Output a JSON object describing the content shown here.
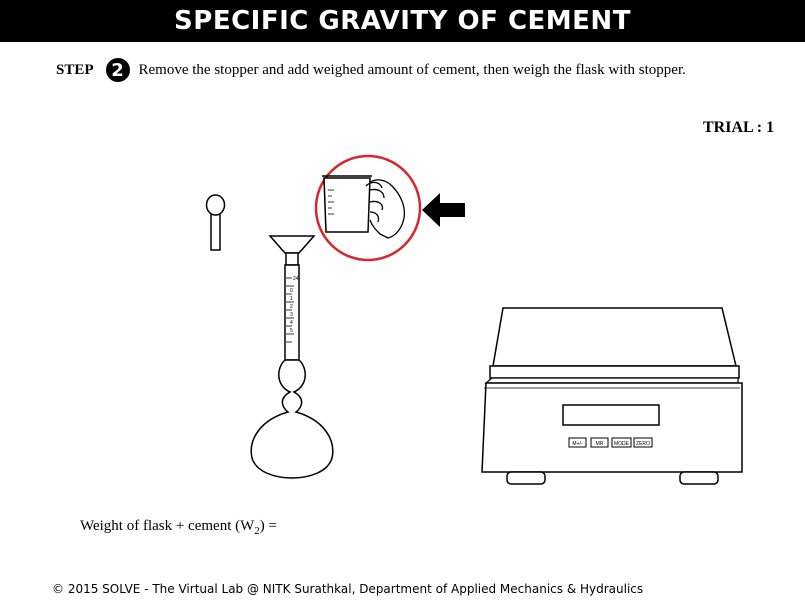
{
  "header": {
    "title": "SPECIFIC GRAVITY OF CEMENT"
  },
  "step": {
    "label": "STEP",
    "number": "2",
    "instruction": "Remove the stopper and add weighed amount of cement, then weigh the flask with stopper."
  },
  "trial": {
    "label": "TRIAL : 1"
  },
  "flask": {
    "scale_marks": [
      "0",
      "1",
      "2",
      "3",
      "4",
      "5",
      "24"
    ]
  },
  "balance": {
    "buttons": [
      "M+/-",
      "MR",
      "MODE",
      "ZERO"
    ]
  },
  "measurement": {
    "prefix": "Weight of flask + cement (W",
    "subscript": "2",
    "suffix": ") ="
  },
  "footer": {
    "text": "© 2015 SOLVE - The Virtual Lab @ NITK Surathkal, Department of Applied Mechanics & Hydraulics"
  },
  "colors": {
    "highlight_circle": "#d9262c",
    "header_bg": "#000000",
    "header_text": "#ffffff"
  },
  "icons": [
    "step-number-badge",
    "arrow-left-icon"
  ]
}
